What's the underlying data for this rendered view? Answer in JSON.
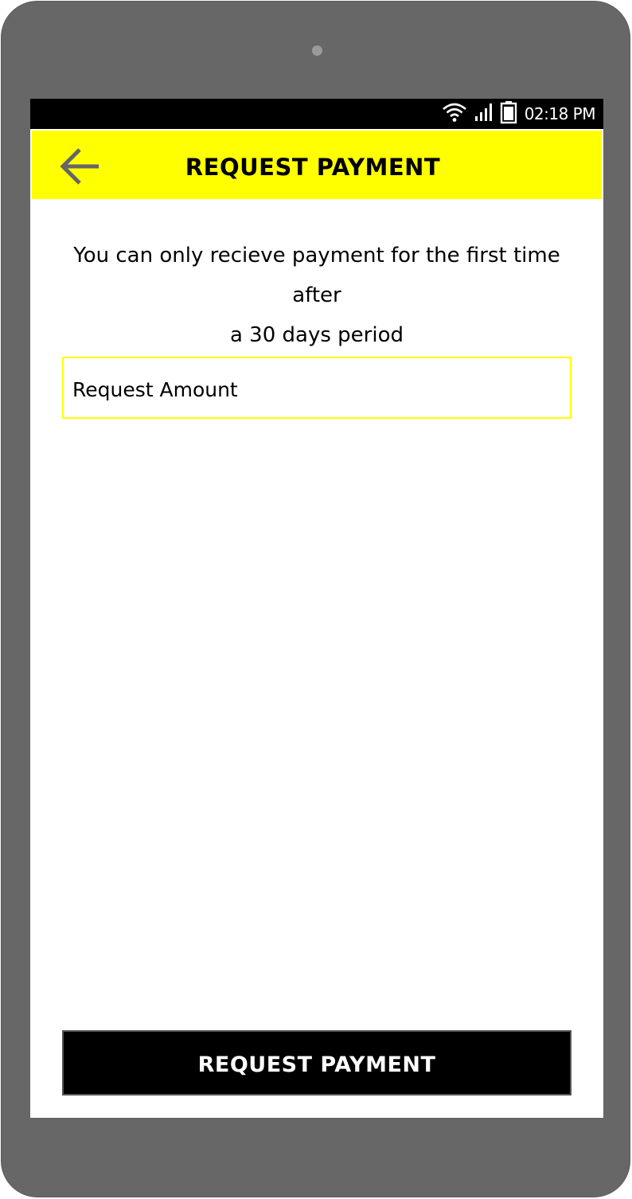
{
  "status_bar": {
    "time": "02:18 PM",
    "icons": [
      "wifi-icon",
      "signal-icon",
      "battery-icon"
    ]
  },
  "app_bar": {
    "title": "REQUEST PAYMENT",
    "back_icon": "arrow-left-icon"
  },
  "content": {
    "info_line_1": "You can only recieve payment for the first time after",
    "info_line_2": "a 30 days period",
    "amount_placeholder": "Request Amount",
    "amount_value": ""
  },
  "actions": {
    "submit_label": "REQUEST PAYMENT"
  },
  "colors": {
    "accent": "#FFFF00",
    "device_frame": "#676767",
    "button_bg": "#000000",
    "status_bar_bg": "#000000"
  }
}
